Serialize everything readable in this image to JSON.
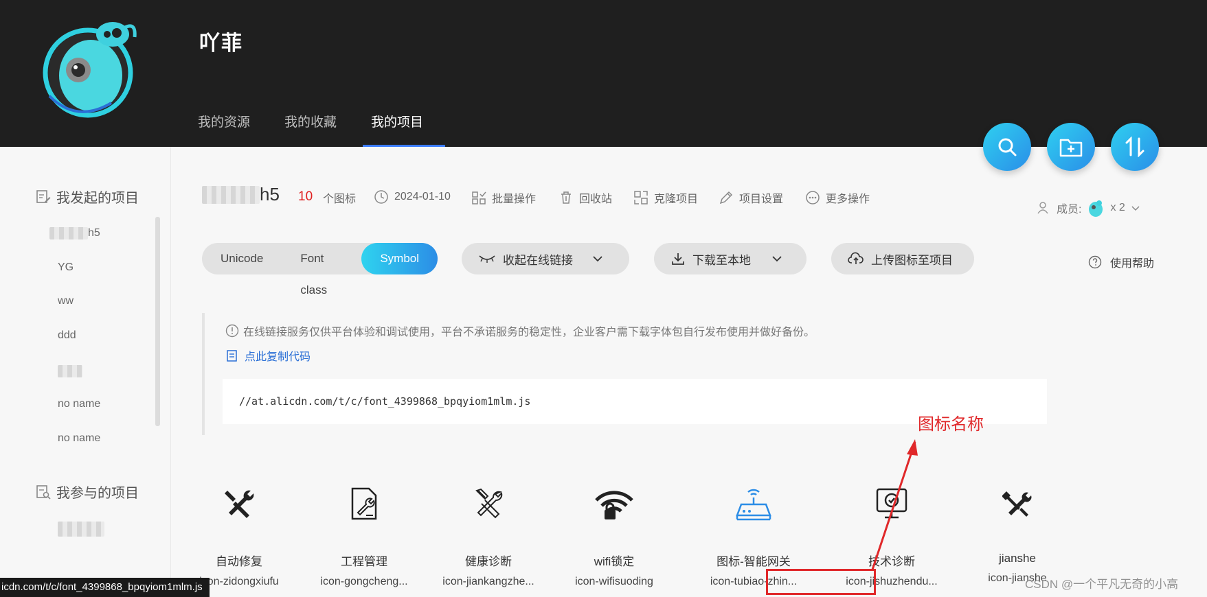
{
  "header": {
    "username": "吖菲",
    "tabs": [
      {
        "label": "我的资源",
        "active": false
      },
      {
        "label": "我的收藏",
        "active": false
      },
      {
        "label": "我的项目",
        "active": true
      }
    ]
  },
  "fab": {
    "icons": [
      "search-icon",
      "add-folder-icon",
      "sort-icon"
    ]
  },
  "sidebar": {
    "own_title": "我发起的项目",
    "own_items": [
      "h5",
      "YG",
      "ww",
      "ddd",
      "",
      "no name",
      "no name"
    ],
    "joined_title": "我参与的项目",
    "next_title_partial": "我"
  },
  "project": {
    "name_suffix": "h5",
    "icon_count": "10",
    "icon_count_label": "个图标",
    "date": "2024-01-10",
    "actions": [
      "批量操作",
      "回收站",
      "克隆项目",
      "项目设置",
      "更多操作"
    ],
    "members_label": "成员:",
    "members_count": "x 2"
  },
  "toolbar": {
    "segments": [
      {
        "label": "Unicode",
        "active": false
      },
      {
        "label": "Font class",
        "active": false
      },
      {
        "label": "Symbol",
        "active": true
      }
    ],
    "collapse_link": "收起在线链接",
    "download": "下载至本地",
    "upload": "上传图标至项目",
    "help": "使用帮助"
  },
  "notice": {
    "text": "在线链接服务仅供平台体验和调试使用，平台不承诺服务的稳定性，企业客户需下载字体包自行发布使用并做好备份。",
    "copy_label": "点此复制代码",
    "code": "//at.alicdn.com/t/c/font_4399868_bpqyiom1mlm.js"
  },
  "icons": [
    {
      "name": "自动修复",
      "code": "icon-zidongxiufu",
      "icon": "tools-icon"
    },
    {
      "name": "工程管理",
      "code": "icon-gongcheng...",
      "icon": "document-wrench-icon"
    },
    {
      "name": "健康诊断",
      "code": "icon-jiankangzhe...",
      "icon": "tools-outline-icon"
    },
    {
      "name": "wifi锁定",
      "code": "icon-wifisuoding",
      "icon": "wifi-lock-icon"
    },
    {
      "name": "图标-智能网关",
      "code": "icon-tubiao-zhin...",
      "icon": "router-icon"
    },
    {
      "name": "技术诊断",
      "code": "icon-jishuzhendu...",
      "icon": "monitor-check-icon"
    },
    {
      "name": "jianshe",
      "code": "icon-jianshe",
      "icon": "wrench-screwdriver-icon"
    }
  ],
  "annotation": {
    "label": "图标名称"
  },
  "status_tip": "icdn.com/t/c/font_4399868_bpqyiom1mlm.js",
  "watermark": "CSDN @一个平凡无奇的小高",
  "colors": {
    "header_bg": "#1f1f1f",
    "accent": "#2a8ee8",
    "accent_light": "#2fd3ef",
    "red": "#e0282a",
    "link": "#2a6fd6"
  }
}
